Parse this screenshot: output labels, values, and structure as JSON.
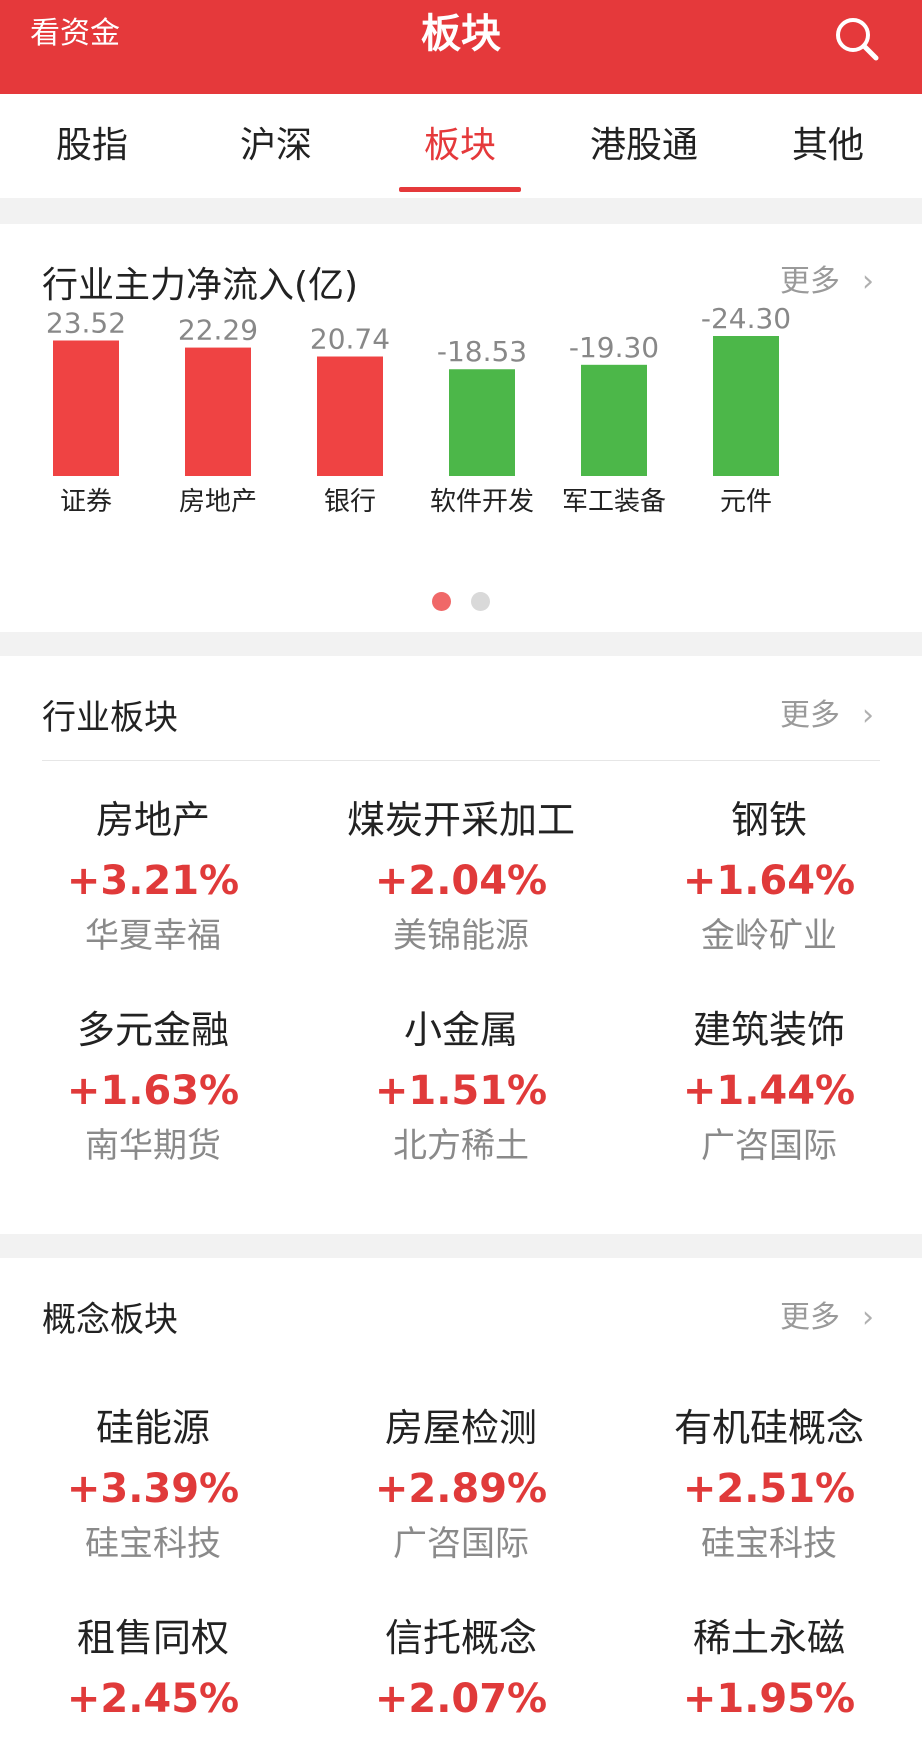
{
  "header": {
    "back_label": "看资金",
    "title": "板块"
  },
  "tabs": [
    {
      "label": "股指"
    },
    {
      "label": "沪深"
    },
    {
      "label": "板块",
      "active": true
    },
    {
      "label": "港股通"
    },
    {
      "label": "其他"
    }
  ],
  "flow": {
    "title": "行业主力净流入(亿)",
    "more": "更多",
    "pages": 2,
    "current_page": 1
  },
  "chart_data": {
    "type": "bar",
    "title": "行业主力净流入(亿)",
    "categories": [
      "证券",
      "房地产",
      "银行",
      "软件开发",
      "军工装备",
      "元件"
    ],
    "values": [
      23.52,
      22.29,
      20.74,
      -18.53,
      -19.3,
      -24.3
    ],
    "value_labels": [
      "23.52",
      "22.29",
      "20.74",
      "-18.53",
      "-19.30",
      "-24.30"
    ],
    "bar_colors": {
      "positive": "#ef4343",
      "negative": "#4cb749"
    },
    "label_color": "#888888",
    "xlabel": "",
    "ylabel": ""
  },
  "industry": {
    "title": "行业板块",
    "more": "更多",
    "items": [
      {
        "name": "房地产",
        "pct": "+3.21%",
        "stock": "华夏幸福"
      },
      {
        "name": "煤炭开采加工",
        "pct": "+2.04%",
        "stock": "美锦能源"
      },
      {
        "name": "钢铁",
        "pct": "+1.64%",
        "stock": "金岭矿业"
      },
      {
        "name": "多元金融",
        "pct": "+1.63%",
        "stock": "南华期货"
      },
      {
        "name": "小金属",
        "pct": "+1.51%",
        "stock": "北方稀土"
      },
      {
        "name": "建筑装饰",
        "pct": "+1.44%",
        "stock": "广咨国际"
      }
    ]
  },
  "concept": {
    "title": "概念板块",
    "more": "更多",
    "items": [
      {
        "name": "硅能源",
        "pct": "+3.39%",
        "stock": "硅宝科技"
      },
      {
        "name": "房屋检测",
        "pct": "+2.89%",
        "stock": "广咨国际"
      },
      {
        "name": "有机硅概念",
        "pct": "+2.51%",
        "stock": "硅宝科技"
      },
      {
        "name": "租售同权",
        "pct": "+2.45%",
        "stock": ""
      },
      {
        "name": "信托概念",
        "pct": "+2.07%",
        "stock": ""
      },
      {
        "name": "稀土永磁",
        "pct": "+1.95%",
        "stock": ""
      }
    ]
  },
  "colors": {
    "brand": "#e5393b",
    "up": "#e03a3a"
  }
}
